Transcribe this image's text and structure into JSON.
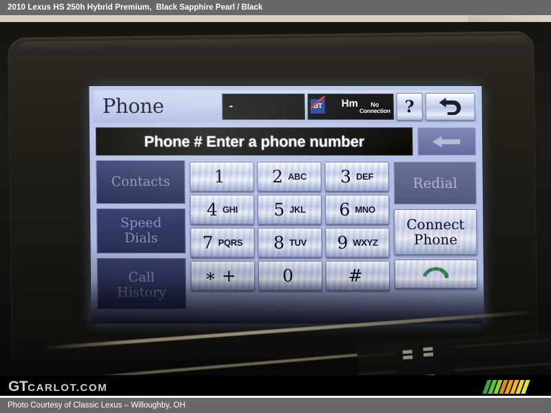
{
  "caption": {
    "vehicle": "2010 Lexus HS 250h Hybrid Premium,",
    "colors": "Black Sapphire Pearl / Black"
  },
  "screen": {
    "header": {
      "title": "Phone",
      "signal_value": "-",
      "bluetooth_label": "BT",
      "bluetooth_state": "disconnected",
      "phone_type": "Hm",
      "connection_line1": "No",
      "connection_line2": "Connection",
      "help_label": "?",
      "back_label": "return-arrow"
    },
    "entry": {
      "prompt": "Phone # Enter a phone number",
      "backspace_label": "backspace-arrow"
    },
    "left_menu": [
      {
        "label": "Contacts",
        "lines": [
          "Contacts"
        ],
        "enabled": false
      },
      {
        "label": "Speed Dials",
        "lines": [
          "Speed",
          "Dials"
        ],
        "enabled": false
      },
      {
        "label": "Call History",
        "lines": [
          "Call",
          "History"
        ],
        "enabled": false
      }
    ],
    "keypad": [
      [
        {
          "digit": "1",
          "letters": ""
        },
        {
          "digit": "2",
          "letters": "ABC"
        },
        {
          "digit": "3",
          "letters": "DEF"
        }
      ],
      [
        {
          "digit": "4",
          "letters": "GHI"
        },
        {
          "digit": "5",
          "letters": "JKL"
        },
        {
          "digit": "6",
          "letters": "MNO"
        }
      ],
      [
        {
          "digit": "7",
          "letters": "PQRS"
        },
        {
          "digit": "8",
          "letters": "TUV"
        },
        {
          "digit": "9",
          "letters": "WXYZ"
        }
      ],
      [
        {
          "digit": "∗ +",
          "letters": ""
        },
        {
          "digit": "0",
          "letters": ""
        },
        {
          "digit": "#",
          "letters": ""
        }
      ]
    ],
    "right_menu": {
      "redial": {
        "label": "Redial",
        "enabled": false
      },
      "connect": {
        "line1": "Connect",
        "line2": "Phone",
        "enabled": true
      },
      "call": {
        "label": "call-handset",
        "enabled": true
      }
    },
    "colors": {
      "lcd_background": "#b6c3ea",
      "header_background": "#c2cdec",
      "entry_background": "#0a0906",
      "key_face": "#d5dcf0",
      "disabled_button": "#333964",
      "bluetooth_blue": "#1b3f96",
      "bluetooth_slash_red": "#e02525",
      "handset_green": "#2f7a4a",
      "text_dark": "#0b0b1d",
      "text_disabled": "#8e96c4"
    }
  },
  "watermark": {
    "logo_gt": "GT",
    "logo_rest": "CARLOT.COM",
    "stripe_colors": [
      "#3fa535",
      "#5cc23f",
      "#8fd136",
      "#d98c1a",
      "#e8a01c",
      "#f0b81e",
      "#ead43a",
      "#e3e04a"
    ]
  },
  "footer": {
    "credit": "Photo Courtesy of Classic Lexus – Willoughby, OH"
  }
}
